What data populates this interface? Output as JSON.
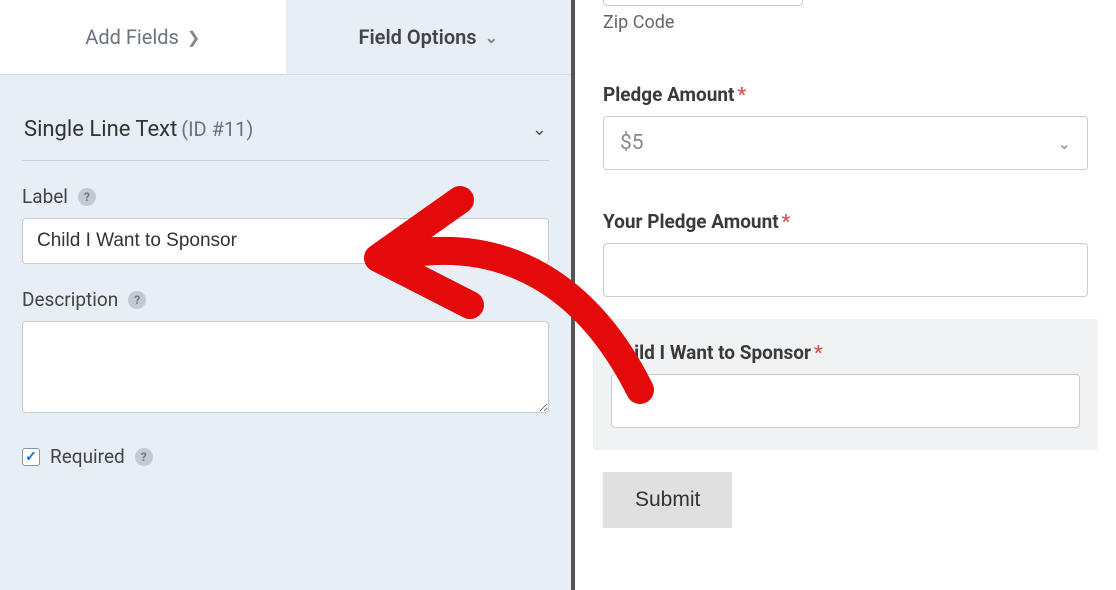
{
  "tabs": {
    "add_fields": "Add Fields",
    "field_options": "Field Options"
  },
  "field": {
    "title": "Single Line Text",
    "id": "(ID #11)"
  },
  "editor": {
    "label_label": "Label",
    "label_value": "Child I Want to Sponsor",
    "description_label": "Description",
    "description_value": "",
    "required_label": "Required"
  },
  "preview": {
    "zip_label": "Zip Code",
    "pledge_label": "Pledge Amount",
    "pledge_value": "$5",
    "your_pledge_label": "Your Pledge Amount",
    "child_label": "Child I Want to Sponsor",
    "submit": "Submit"
  }
}
